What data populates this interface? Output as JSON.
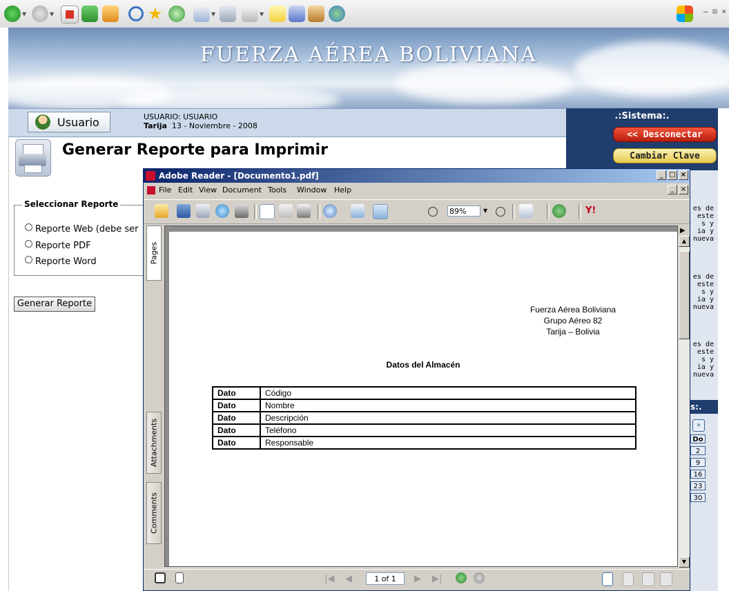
{
  "browser": {
    "window_controls": "– ⊡ ×"
  },
  "banner": {
    "title": "FUERZA AÉREA BOLIVIANA"
  },
  "user": {
    "button_label": "Usuario",
    "info_line1": "USUARIO: USUARIO",
    "info_city": "Tarija",
    "info_date": "13 - Noviembre - 2008"
  },
  "system": {
    "title": ".:Sistema:.",
    "disconnect_label": "<< Desconectar",
    "change_password_label": "Cambiar Clave",
    "side_text_fragments": [
      "es de",
      "este",
      "s   y",
      "ia   y",
      "nueva"
    ],
    "section2_label": "s:.",
    "calendar_header": "Do",
    "calendar_days": [
      "2",
      "9",
      "16",
      "23",
      "30"
    ]
  },
  "page": {
    "title": "Generar Reporte para Imprimir",
    "fieldset_legend": "Seleccionar Reporte",
    "options": [
      "Reporte Web (debe ser",
      "Reporte PDF",
      "Reporte Word"
    ],
    "generate_button": "Generar Reporte"
  },
  "adobe": {
    "title": "Adobe Reader - [Documento1.pdf]",
    "menu": [
      "File",
      "Edit",
      "View",
      "Document",
      "Tools",
      "Window",
      "Help"
    ],
    "zoom": "89%",
    "side_tabs": [
      "Pages",
      "Attachments",
      "Comments"
    ],
    "page_indicator": "1 of 1",
    "document": {
      "company_lines": [
        "Fuerza Aérea Boliviana",
        "Grupo Aéreo 82",
        "Tarija – Bolivia"
      ],
      "heading": "Datos del Almacén",
      "rows": [
        {
          "key": "Dato",
          "value": "Código"
        },
        {
          "key": "Dato",
          "value": "Nombre"
        },
        {
          "key": "Dato",
          "value": "Descripción"
        },
        {
          "key": "Dato",
          "value": "Teléfono"
        },
        {
          "key": "Dato",
          "value": "Responsable"
        }
      ]
    }
  }
}
